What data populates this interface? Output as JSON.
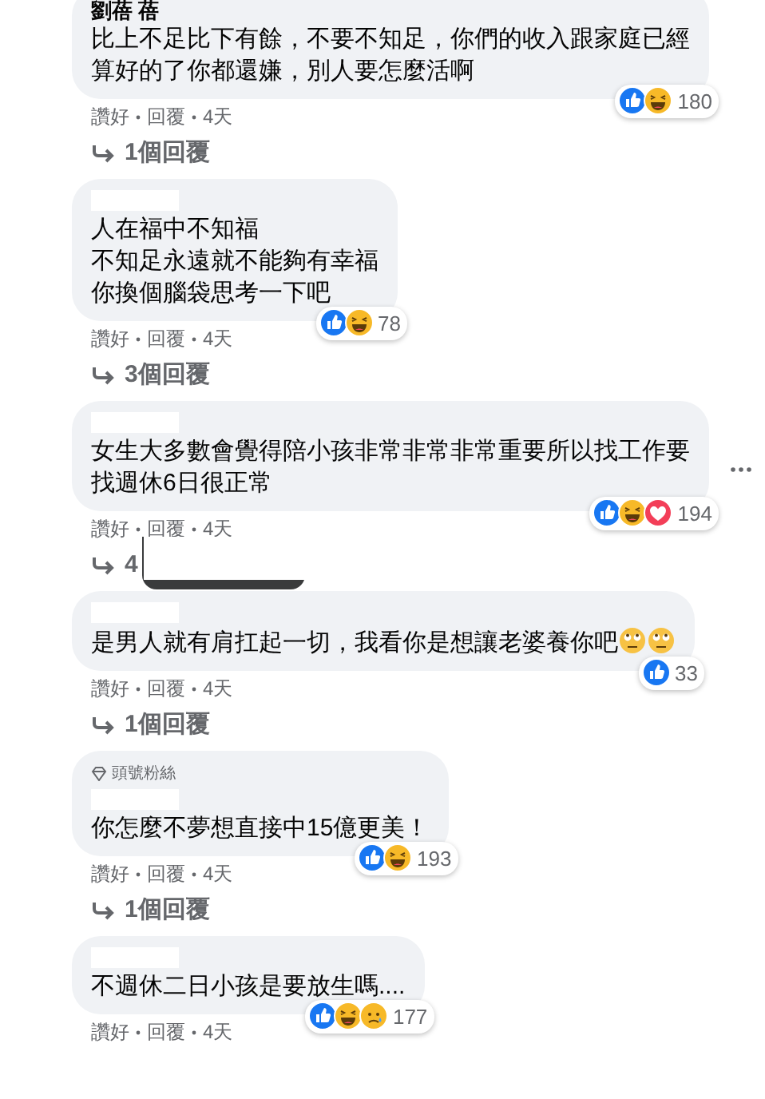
{
  "comments": [
    {
      "name": "劉蓓 蓓",
      "name_redacted": false,
      "lines": [
        "比上不足比下有餘，不要不知足，你們的收入跟家庭已經",
        "算好的了你都還嫌，別人要怎麼活啊"
      ],
      "reactions": [
        {
          "kind": "like"
        },
        {
          "kind": "haha"
        }
      ],
      "reaction_count": "180",
      "like": "讚好",
      "reply": "回覆",
      "time": "4天",
      "time_hovered": false,
      "more_menu": false,
      "replies": "1個回覆",
      "replies_covered": false
    },
    {
      "name_redacted": true,
      "lines": [
        "人在福中不知福",
        "不知足永遠就不能夠有幸福",
        "你換個腦袋思考一下吧"
      ],
      "reactions": [
        {
          "kind": "like"
        },
        {
          "kind": "haha"
        }
      ],
      "reaction_count": "78",
      "like": "讚好",
      "reply": "回覆",
      "time": "4天",
      "time_hovered": false,
      "more_menu": false,
      "replies": "3個回覆",
      "replies_covered": false
    },
    {
      "name_redacted": true,
      "lines": [
        "女生大多數會覺得陪小孩非常非常非常重要所以找工作要",
        "找週休6日很正常"
      ],
      "reactions": [
        {
          "kind": "like"
        },
        {
          "kind": "haha"
        },
        {
          "kind": "love"
        }
      ],
      "reaction_count": "194",
      "like": "讚好",
      "reply": "回覆",
      "time": "4天",
      "time_hovered": true,
      "more_menu": true,
      "replies": "4",
      "replies_covered": true
    },
    {
      "name_redacted": true,
      "lines": [
        "是男人就有肩扛起一切，我看你是想讓老婆養你吧"
      ],
      "emojis": [
        {
          "kind": "eye-roll"
        },
        {
          "kind": "eye-roll"
        }
      ],
      "reactions": [
        {
          "kind": "like"
        }
      ],
      "reaction_count": "33",
      "like": "讚好",
      "reply": "回覆",
      "time": "4天",
      "time_hovered": false,
      "more_menu": false,
      "replies": "1個回覆",
      "replies_covered": false
    },
    {
      "badge": "頭號粉絲",
      "name_redacted": true,
      "lines": [
        "你怎麼不夢想直接中15億更美！"
      ],
      "reactions": [
        {
          "kind": "like"
        },
        {
          "kind": "haha"
        }
      ],
      "reaction_count": "193",
      "like": "讚好",
      "reply": "回覆",
      "time": "4天",
      "time_hovered": false,
      "more_menu": false,
      "replies": "1個回覆",
      "replies_covered": false
    },
    {
      "name_redacted": true,
      "lines": [
        "不週休二日小孩是要放生嗎...."
      ],
      "reactions": [
        {
          "kind": "like"
        },
        {
          "kind": "haha"
        },
        {
          "kind": "sad"
        }
      ],
      "reaction_count": "177",
      "like": "讚好",
      "reply": "回覆",
      "time": "4天",
      "time_hovered": false,
      "more_menu": false
    }
  ]
}
